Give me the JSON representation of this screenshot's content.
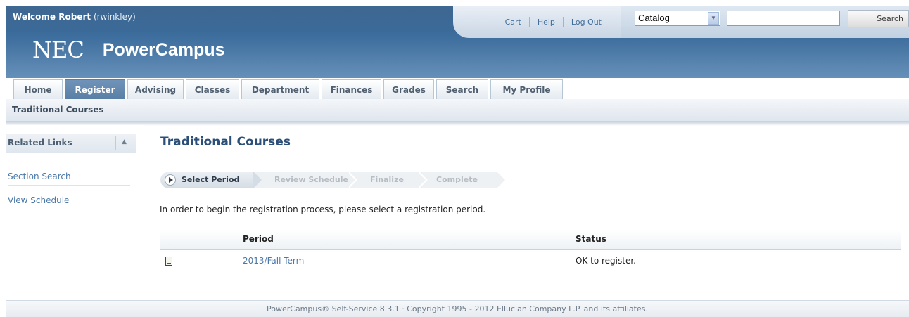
{
  "header": {
    "welcome_prefix": "Welcome Robert",
    "welcome_user": "(rwinkley)",
    "logo_mark": "NEC",
    "logo_text": "PowerCampus",
    "utility_links": [
      "Cart",
      "Help",
      "Log Out"
    ],
    "search": {
      "scope_selected": "Catalog",
      "query_value": "",
      "button_label": "Search"
    }
  },
  "tabs": [
    {
      "label": "Home",
      "active": false
    },
    {
      "label": "Register",
      "active": true
    },
    {
      "label": "Advising",
      "active": false
    },
    {
      "label": "Classes",
      "active": false
    },
    {
      "label": "Department",
      "active": false
    },
    {
      "label": "Finances",
      "active": false
    },
    {
      "label": "Grades",
      "active": false
    },
    {
      "label": "Search",
      "active": false
    },
    {
      "label": "My Profile",
      "active": false
    }
  ],
  "subnav": {
    "current": "Traditional Courses"
  },
  "sidebar": {
    "title": "Related Links",
    "links": [
      "Section Search",
      "View Schedule"
    ]
  },
  "main": {
    "title": "Traditional Courses",
    "steps": [
      {
        "label": "Select Period",
        "active": true
      },
      {
        "label": "Review Schedule",
        "active": false
      },
      {
        "label": "Finalize",
        "active": false
      },
      {
        "label": "Complete",
        "active": false
      }
    ],
    "instruction": "In order to begin the registration process, please select a registration period.",
    "table": {
      "headers": [
        "Period",
        "Status"
      ],
      "rows": [
        {
          "period": "2013/Fall Term",
          "status": "OK to register."
        }
      ]
    }
  },
  "footer": {
    "text": "PowerCampus® Self-Service 8.3.1 · Copyright 1995 - 2012 Ellucian Company L.P. and its affiliates."
  },
  "colors": {
    "header_blue": "#3f6f9e",
    "link_blue": "#4a78a8",
    "title_blue": "#2b4f78"
  }
}
